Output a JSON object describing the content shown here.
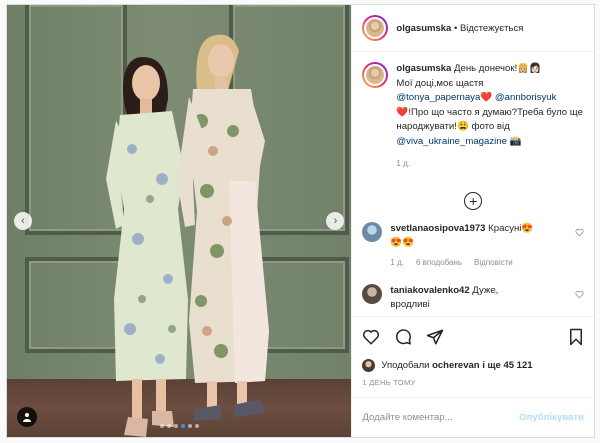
{
  "header": {
    "username": "olgasumska",
    "separator": " • ",
    "follow_status": "Відстежується"
  },
  "caption": {
    "username": "olgasumska",
    "line1": "День донечок!👸🏼👩🏻",
    "line2": "Мої доці,моє щастя",
    "mention1": "@tonya_papernaya",
    "heart1": "❤️",
    "mention2": "@annborisyuk",
    "heart2": "❤️",
    "line3": "!Про що часто я думаю?Треба було ще народжувати!😩 фото від",
    "mention3": "@viva_ukraine_magazine",
    "camera": "📸",
    "time": "1 д."
  },
  "comments": [
    {
      "username": "svetlanaosipova1973",
      "text": "Красуні😍",
      "text2": "😍😍",
      "time": "1 д.",
      "likes": "6 вподобань",
      "reply": "Відповісти"
    },
    {
      "username": "taniakovalenko42",
      "text": "Дуже,",
      "text2": "вродливі"
    }
  ],
  "likes": {
    "prefix": "Уподобали ",
    "user": "ocherevan",
    "suffix": " і ще 45 121"
  },
  "posted_ago": "1 ДЕНЬ ТОМУ",
  "add_comment": {
    "placeholder": "Додайте коментар...",
    "publish": "Опублікувати"
  },
  "carousel": {
    "total": 6,
    "active_index": 3
  },
  "colors": {
    "accent": "#3897f0",
    "heart": "#ed4956",
    "publish_disabled": "#b2dffc"
  },
  "icons": [
    "heart-icon",
    "comment-icon",
    "share-icon",
    "bookmark-icon",
    "plus-circle-icon",
    "user-tag-icon",
    "chevron-left-icon",
    "chevron-right-icon"
  ]
}
